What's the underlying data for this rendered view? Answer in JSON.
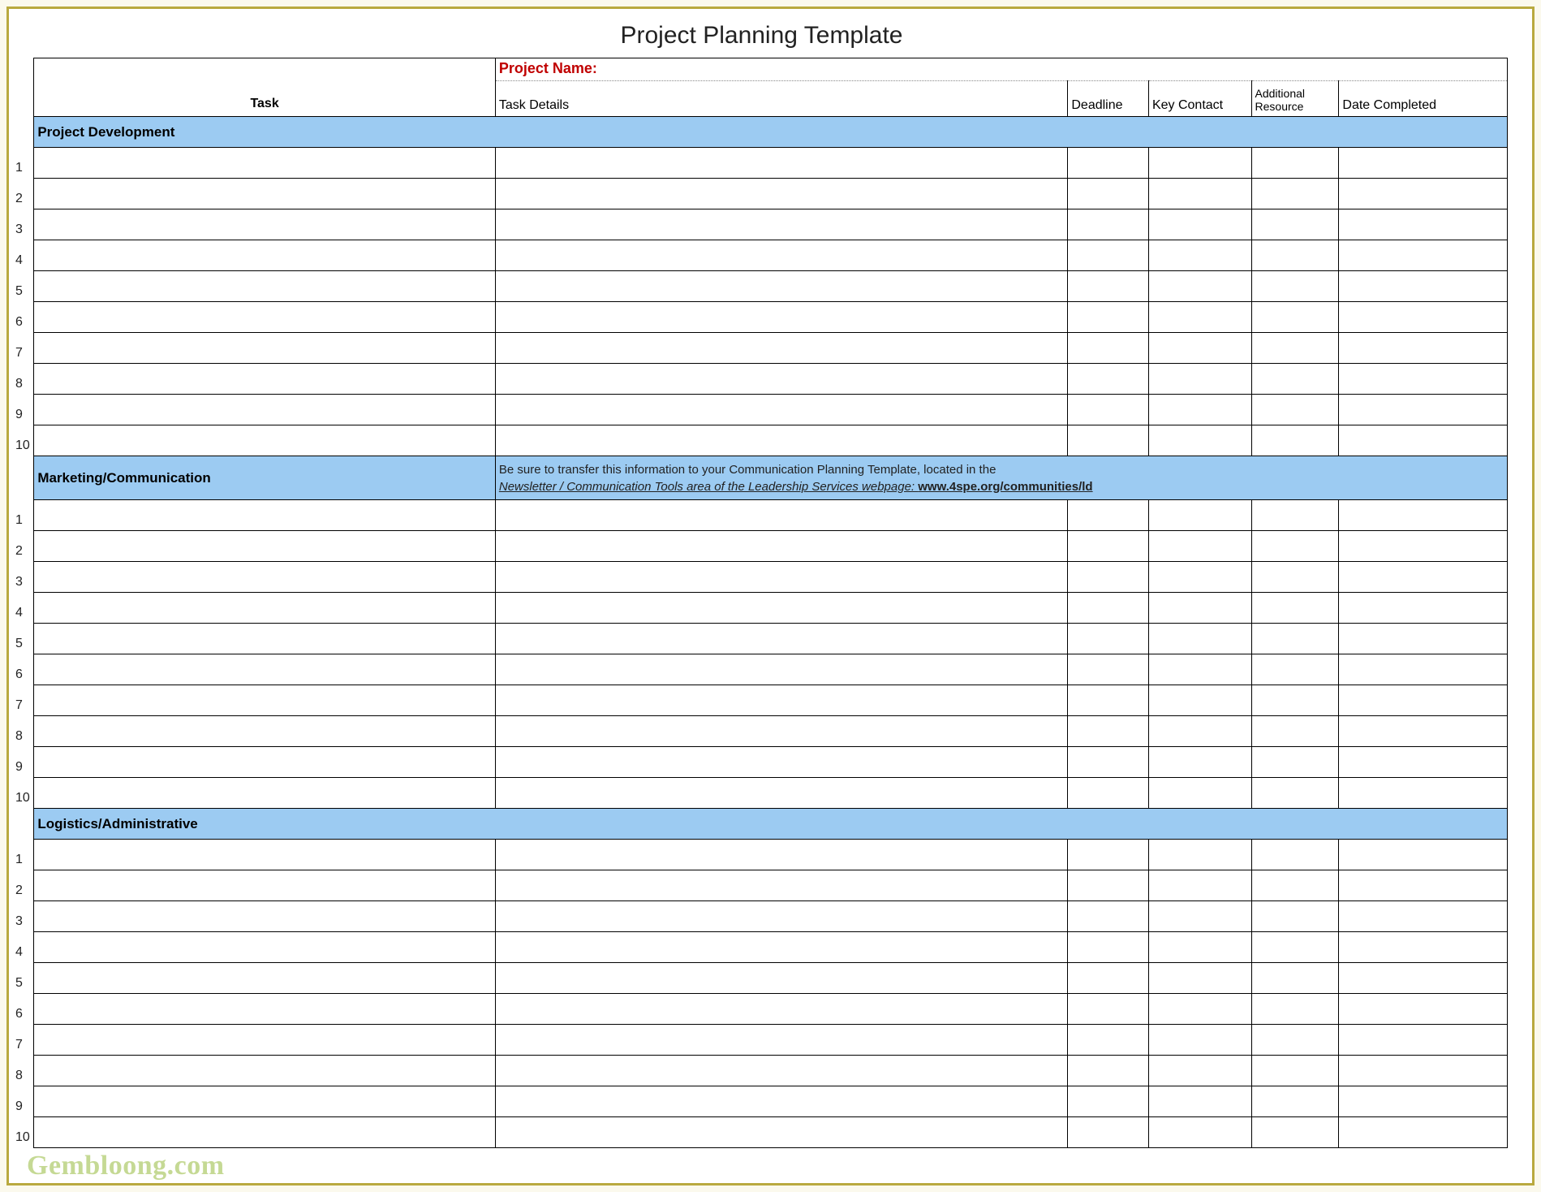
{
  "title": "Project Planning Template",
  "header": {
    "project_name_label": "Project Name:",
    "task": "Task",
    "task_details": "Task Details",
    "deadline": "Deadline",
    "key_contact": "Key Contact",
    "additional_resource": "Additional Resource",
    "date_completed": "Date Completed"
  },
  "sections": [
    {
      "name": "Project Development",
      "note_line1": "",
      "note_line2": "",
      "note_link": "",
      "rows": [
        "1",
        "2",
        "3",
        "4",
        "5",
        "6",
        "7",
        "8",
        "9",
        "10"
      ]
    },
    {
      "name": "Marketing/Communication",
      "note_line1": "Be sure to transfer this information to your Communication Planning Template, located in the",
      "note_line2": "Newsletter / Communication Tools  area of the Leadership Services webpage: ",
      "note_link": "www.4spe.org/communities/ld",
      "rows": [
        "1",
        "2",
        "3",
        "4",
        "5",
        "6",
        "7",
        "8",
        "9",
        "10"
      ]
    },
    {
      "name": "Logistics/Administrative",
      "note_line1": "",
      "note_line2": "",
      "note_link": "",
      "rows": [
        "1",
        "2",
        "3",
        "4",
        "5",
        "6",
        "7",
        "8",
        "9",
        "10"
      ]
    }
  ],
  "watermark": "Gembloong.com"
}
